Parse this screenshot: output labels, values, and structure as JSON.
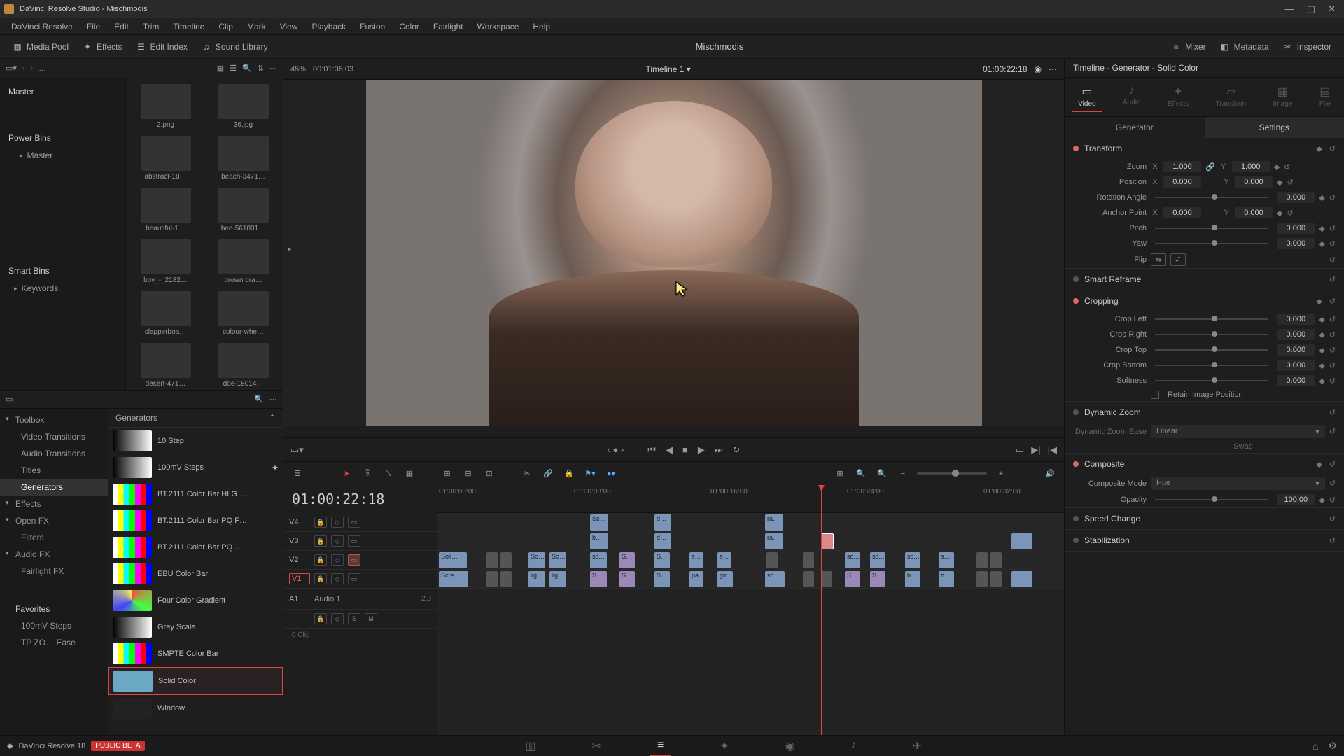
{
  "window": {
    "title": "DaVinci Resolve Studio - Mischmodis"
  },
  "menubar": [
    "DaVinci Resolve",
    "File",
    "Edit",
    "Trim",
    "Timeline",
    "Clip",
    "Mark",
    "View",
    "Playback",
    "Fusion",
    "Color",
    "Fairlight",
    "Workspace",
    "Help"
  ],
  "toolbar": {
    "media_pool": "Media Pool",
    "effects": "Effects",
    "edit_index": "Edit Index",
    "sound_library": "Sound Library",
    "project": "Mischmodis",
    "mixer": "Mixer",
    "metadata": "Metadata",
    "inspector": "Inspector"
  },
  "media": {
    "zoom": "45%",
    "tc": "00:01:06:03",
    "bins": {
      "master": "Master",
      "power": "Power Bins",
      "power_master": "Master",
      "smart": "Smart Bins",
      "keywords": "Keywords"
    },
    "thumbs": [
      "2.png",
      "36.jpg",
      "abstract-18…",
      "beach-3471…",
      "beautiful-1…",
      "bee-561801…",
      "boy_-_2182…",
      "brown gra…",
      "clapperboa…",
      "colour-whe…",
      "desert-471…",
      "doe-18014…"
    ]
  },
  "fx": {
    "tree": {
      "toolbox": "Toolbox",
      "video_trans": "Video Transitions",
      "audio_trans": "Audio Transitions",
      "titles": "Titles",
      "generators": "Generators",
      "effects": "Effects",
      "openfx": "Open FX",
      "filters": "Filters",
      "audiofx": "Audio FX",
      "fairlight": "Fairlight FX",
      "favorites": "Favorites",
      "fav1": "100mV Steps",
      "fav2": "TP ZO… Ease"
    },
    "hdr": "Generators",
    "items": [
      "10 Step",
      "100mV Steps",
      "BT.2111 Color Bar HLG …",
      "BT.2111 Color Bar PQ F…",
      "BT.2111 Color Bar PQ …",
      "EBU Color Bar",
      "Four Color Gradient",
      "Grey Scale",
      "SMPTE Color Bar",
      "Solid Color",
      "Window"
    ]
  },
  "viewer": {
    "timeline_name": "Timeline 1",
    "tc": "01:00:22:18"
  },
  "timeline": {
    "tc": "01:00:22:18",
    "ruler": [
      "01:00:00:00",
      "01:00:08:00",
      "01:00:16:00",
      "01:00:24:00",
      "01:00:32:00"
    ],
    "tracks": {
      "v4": "V4",
      "v3": "V3",
      "v2": "V2",
      "v1": "V1",
      "a1": "A1",
      "a1name": "Audio 1",
      "a1lvl": "2.0",
      "clips": "0 Clip"
    }
  },
  "inspector": {
    "title": "Timeline - Generator - Solid Color",
    "tabs": {
      "video": "Video",
      "audio": "Audio",
      "effects": "Effects",
      "transition": "Transition",
      "image": "Image",
      "file": "File"
    },
    "subtabs": {
      "generator": "Generator",
      "settings": "Settings"
    },
    "transform": {
      "hdr": "Transform",
      "zoom": "Zoom",
      "zoom_x": "1.000",
      "zoom_y": "1.000",
      "position": "Position",
      "pos_x": "0.000",
      "pos_y": "0.000",
      "rotation": "Rotation Angle",
      "rot_v": "0.000",
      "anchor": "Anchor Point",
      "anc_x": "0.000",
      "anc_y": "0.000",
      "pitch": "Pitch",
      "pitch_v": "0.000",
      "yaw": "Yaw",
      "yaw_v": "0.000",
      "flip": "Flip"
    },
    "reframe": "Smart Reframe",
    "cropping": {
      "hdr": "Cropping",
      "left": "Crop Left",
      "left_v": "0.000",
      "right": "Crop Right",
      "right_v": "0.000",
      "top": "Crop Top",
      "top_v": "0.000",
      "bottom": "Crop Bottom",
      "bottom_v": "0.000",
      "soft": "Softness",
      "soft_v": "0.000",
      "retain": "Retain Image Position"
    },
    "dzoom": {
      "hdr": "Dynamic Zoom",
      "ease": "Dynamic Zoom Ease",
      "ease_v": "Linear",
      "swap": "Swap"
    },
    "composite": {
      "hdr": "Composite",
      "mode": "Composite Mode",
      "mode_v": "Hue",
      "opacity": "Opacity",
      "opacity_v": "100.00"
    },
    "speed": "Speed Change",
    "stab": "Stabilization"
  },
  "footer": {
    "app": "DaVinci Resolve 18",
    "beta": "PUBLIC BETA"
  }
}
